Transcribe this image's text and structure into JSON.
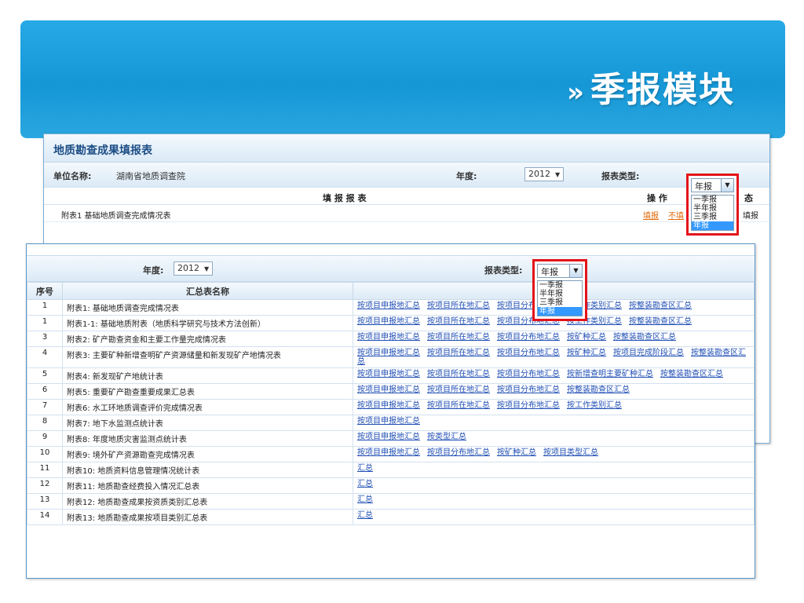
{
  "slide": {
    "title": "季报模块",
    "title_arrow": "»"
  },
  "back_panel": {
    "title": "地质勘查成果填报表",
    "unit_label": "单位名称:",
    "unit_value": "湖南省地质调查院",
    "year_label": "年度:",
    "year_value": "2012",
    "type_label": "报表类型:",
    "col_fill": "填 报 报 表",
    "col_ops": "操 作",
    "col_state": "态",
    "row1_name": "附表1 基础地质调查完成情况表",
    "row1_fill": "填报",
    "row1_nofill": "不填",
    "row1_state": "填报",
    "side_chars": [
      "表",
      "表",
      "表",
      "表",
      "表",
      "表",
      "表"
    ]
  },
  "report_type_options": [
    "一季报",
    "半年报",
    "三季报",
    "年报"
  ],
  "report_type_selected": "年报",
  "front_panel": {
    "year_label": "年度:",
    "year_value": "2012",
    "type_label": "报表类型:",
    "col_seq": "序号",
    "col_name": "汇总表名称",
    "rows": [
      {
        "seq": "1",
        "name": "附表1: 基础地质调查完成情况表",
        "links": [
          "按项目申报地汇总",
          "按项目所在地汇总",
          "按项目分布地汇总",
          "按工作类别汇总",
          "按整装勘查区汇总"
        ]
      },
      {
        "seq": "1",
        "name": "附表1-1:  基础地质附表（地质科学研究与技术方法创新）",
        "links": [
          "按项目申报地汇总",
          "按项目所在地汇总",
          "按项目分布地汇总",
          "按工作类别汇总",
          "按整装勘查区汇总"
        ]
      },
      {
        "seq": "3",
        "name": "附表2: 矿产勘查资金和主要工作量完成情况表",
        "links": [
          "按项目申报地汇总",
          "按项目所在地汇总",
          "按项目分布地汇总",
          "按矿种汇总",
          "按整装勘查区汇总"
        ]
      },
      {
        "seq": "4",
        "name": "附表3: 主要矿种新增查明矿产资源储量和新发现矿产地情况表",
        "links": [
          "按项目申报地汇总",
          "按项目所在地汇总",
          "按项目分布地汇总",
          "按矿种汇总",
          "按项目完成阶段汇总",
          "按整装勘查区汇总"
        ]
      },
      {
        "seq": "5",
        "name": "附表4: 新发现矿产地统计表",
        "links": [
          "按项目申报地汇总",
          "按项目所在地汇总",
          "按项目分布地汇总",
          "按新增查明主要矿种汇总",
          "按整装勘查区汇总"
        ]
      },
      {
        "seq": "6",
        "name": "附表5: 重要矿产勘查重要成果汇总表",
        "links": [
          "按项目申报地汇总",
          "按项目所在地汇总",
          "按项目分布地汇总",
          "按整装勘查区汇总"
        ]
      },
      {
        "seq": "7",
        "name": "附表6: 水工环地质调查评价完成情况表",
        "links": [
          "按项目申报地汇总",
          "按项目所在地汇总",
          "按项目分布地汇总",
          "按工作类别汇总"
        ]
      },
      {
        "seq": "8",
        "name": "附表7: 地下水监测点统计表",
        "links": [
          "按项目申报地汇总"
        ]
      },
      {
        "seq": "9",
        "name": "附表8: 年度地质灾害监测点统计表",
        "links": [
          "按项目申报地汇总",
          "按类型汇总"
        ]
      },
      {
        "seq": "10",
        "name": "附表9: 境外矿产资源勘查完成情况表",
        "links": [
          "按项目申报地汇总",
          "按项目分布地汇总",
          "按矿种汇总",
          "按项目类型汇总"
        ]
      },
      {
        "seq": "11",
        "name": "附表10: 地质资料信息管理情况统计表",
        "links": [
          "汇总"
        ]
      },
      {
        "seq": "12",
        "name": "附表11: 地质勘查经费投入情况汇总表",
        "links": [
          "汇总"
        ]
      },
      {
        "seq": "13",
        "name": "附表12: 地质勘查成果按资质类别汇总表",
        "links": [
          "汇总"
        ]
      },
      {
        "seq": "14",
        "name": "附表13: 地质勘查成果按项目类别汇总表",
        "links": [
          "汇总"
        ]
      }
    ]
  },
  "colors": {
    "banner": "#1597d6",
    "highlight": "#e3141a",
    "link": "#1f4eb4",
    "panel_border": "#7aaed6"
  }
}
